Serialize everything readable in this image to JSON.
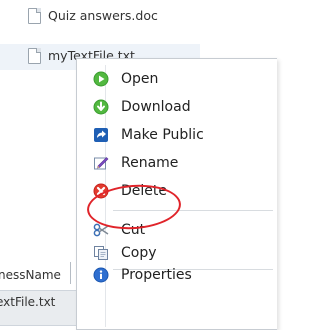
{
  "files": [
    {
      "name": "Quiz answers.doc"
    },
    {
      "name": "myTextFile.txt"
    }
  ],
  "context_menu": {
    "items": [
      {
        "label": "Open",
        "icon": "open-icon"
      },
      {
        "label": "Download",
        "icon": "download-icon"
      },
      {
        "label": "Make Public",
        "icon": "make-public-icon"
      },
      {
        "label": "Rename",
        "icon": "rename-icon"
      },
      {
        "label": "Delete",
        "icon": "delete-icon"
      },
      {
        "label": "Cut",
        "icon": "cut-icon"
      },
      {
        "label": "Copy",
        "icon": "copy-icon"
      },
      {
        "label": "Properties",
        "icon": "properties-icon"
      }
    ]
  },
  "table": {
    "column_header": "nessName",
    "cell_value": "extFile.txt"
  },
  "colors": {
    "highlight_ring": "#e0242a",
    "selected_row": "#eef3f9"
  }
}
